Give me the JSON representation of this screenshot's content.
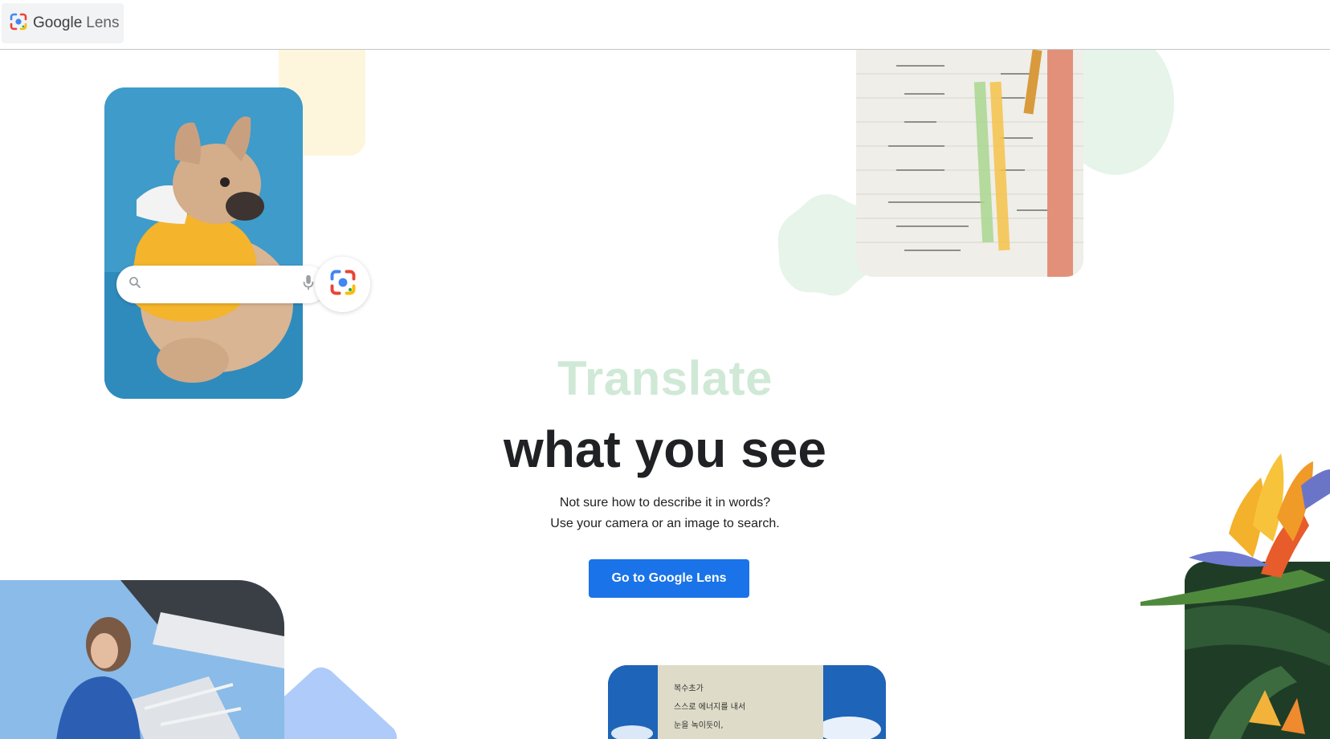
{
  "header": {
    "brand_google": "Google",
    "brand_lens": "Lens"
  },
  "hero": {
    "rotating_word": "Translate",
    "headline": "what you see",
    "description_line1": "Not sure how to describe it in words?",
    "description_line2": "Use your camera or an image to search.",
    "cta_label": "Go to Google Lens"
  },
  "korean_note": [
    "복수초가",
    "스스로 에너지를 내서",
    "눈을 녹이듯이,"
  ],
  "colors": {
    "accent_blue": "#1a73e8",
    "rotating_word_green": "#cfe9d6",
    "cream_shape": "#fdf6dd",
    "mint_shape": "#e6f4ea",
    "periwinkle_shape": "#aecbfa"
  },
  "icons": [
    "google-lens-logo-icon",
    "search-icon",
    "mic-icon",
    "lens-camera-icon"
  ]
}
